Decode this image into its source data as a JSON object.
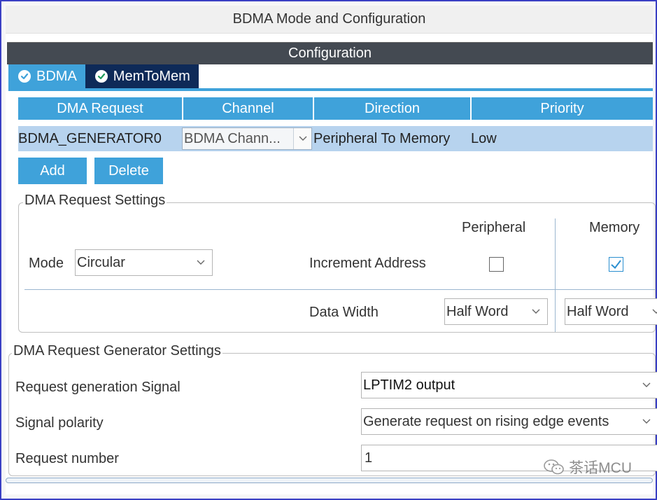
{
  "window": {
    "title": "BDMA Mode and Configuration"
  },
  "config_bar": {
    "label": "Configuration"
  },
  "tabs": [
    {
      "label": "BDMA",
      "active": true,
      "icon": "check-circle-icon"
    },
    {
      "label": "MemToMem",
      "active": false,
      "icon": "check-circle-icon"
    }
  ],
  "table": {
    "headers": [
      "DMA Request",
      "Channel",
      "Direction",
      "Priority"
    ],
    "rows": [
      {
        "request": "BDMA_GENERATOR0",
        "channel": "BDMA Chann...",
        "direction": "Peripheral To Memory",
        "priority": "Low"
      }
    ]
  },
  "buttons": {
    "add": "Add",
    "delete": "Delete"
  },
  "request_settings": {
    "legend": "DMA Request Settings",
    "mode_label": "Mode",
    "mode_value": "Circular",
    "peripheral_header": "Peripheral",
    "memory_header": "Memory",
    "increment_label": "Increment Address",
    "peripheral_increment": false,
    "memory_increment": true,
    "data_width_label": "Data Width",
    "peripheral_width": "Half Word",
    "memory_width": "Half Word"
  },
  "generator_settings": {
    "legend": "DMA Request Generator Settings",
    "signal_label": "Request generation Signal",
    "signal_value": "LPTIM2 output",
    "polarity_label": "Signal polarity",
    "polarity_value": "Generate request on rising edge events",
    "number_label": "Request number",
    "number_value": "1"
  },
  "watermark": {
    "text": "茶话MCU",
    "icon": "wechat-icon"
  },
  "colors": {
    "accent": "#3fa2da",
    "dark_tab": "#0e2a58",
    "config_bar": "#444a52",
    "row_selected": "#b7d3ee"
  }
}
